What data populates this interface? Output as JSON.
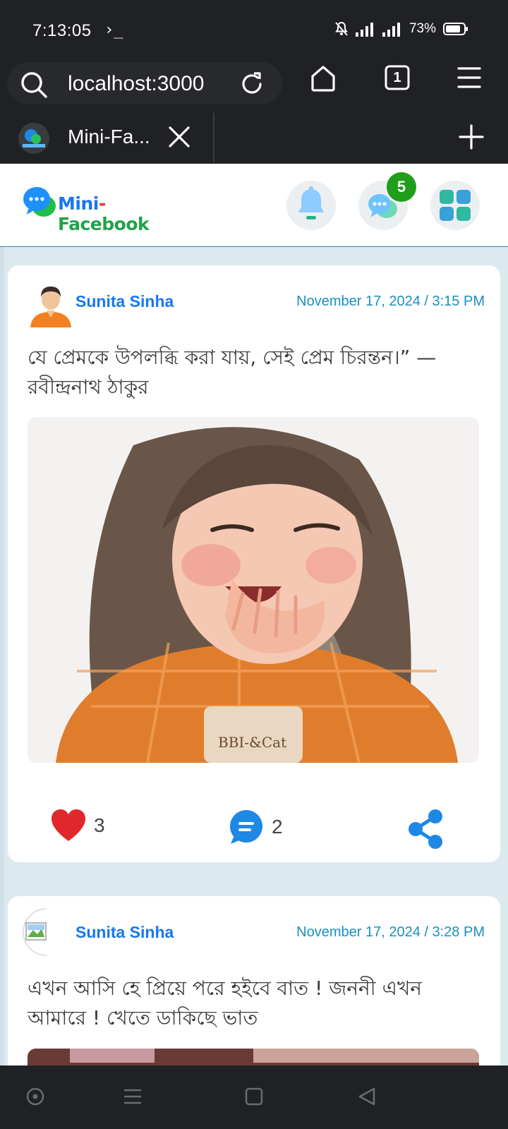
{
  "status_bar": {
    "time": "7:13:05",
    "terminal_glyph": "›_",
    "battery_percent": "73%",
    "icons": [
      "mute-icon",
      "signal-icon",
      "signal-icon",
      "battery-icon"
    ]
  },
  "browser": {
    "url": "localhost:3000",
    "tab_count": "1",
    "tab_title": "Mini-Fa..."
  },
  "app": {
    "logo_mini": "Mini",
    "logo_dash": "-",
    "logo_facebook": "Facebook",
    "message_badge": "5",
    "colors": {
      "brand_blue": "#1877f2",
      "header_border": "#2a8db0",
      "feed_bg": "#dceaf0",
      "badge_green": "#1f9e19",
      "heart_red": "#e0272c"
    }
  },
  "posts": [
    {
      "author": "Sunita Sinha",
      "date": "November 17, 2024 / 3:15 PM",
      "text": "যে প্রেমকে উপলব্ধি করা যায়, সেই প্রেম চিরন্তন।” — রবীন্দ্রনাথ ঠাকুর",
      "likes": "3",
      "comments": "2",
      "image_caption": "BBI-&Cat"
    },
    {
      "author": "Sunita Sinha",
      "date": "November 17, 2024 / 3:28 PM",
      "text": "এখন আসি হে প্রিয়ে পরে হইবে বাত ! জননী এখন আমারে ! খেতে ডাকিছে ভাত"
    }
  ]
}
